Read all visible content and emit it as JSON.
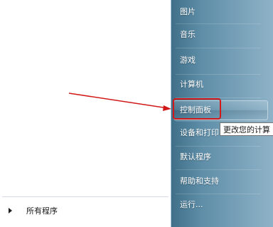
{
  "start_menu": {
    "left": {
      "all_programs_label": "所有程序"
    },
    "right": {
      "items": [
        {
          "label": "图片"
        },
        {
          "label": "音乐"
        },
        {
          "label": "游戏"
        },
        {
          "label": "计算机"
        },
        {
          "label": "控制面板"
        },
        {
          "label": "设备和打印"
        },
        {
          "label": "默认程序"
        },
        {
          "label": "帮助和支持"
        },
        {
          "label": "运行..."
        }
      ],
      "active_index": 4
    }
  },
  "tooltip": {
    "text": "更改您的计算"
  },
  "colors": {
    "annotation_red": "#d21919"
  }
}
